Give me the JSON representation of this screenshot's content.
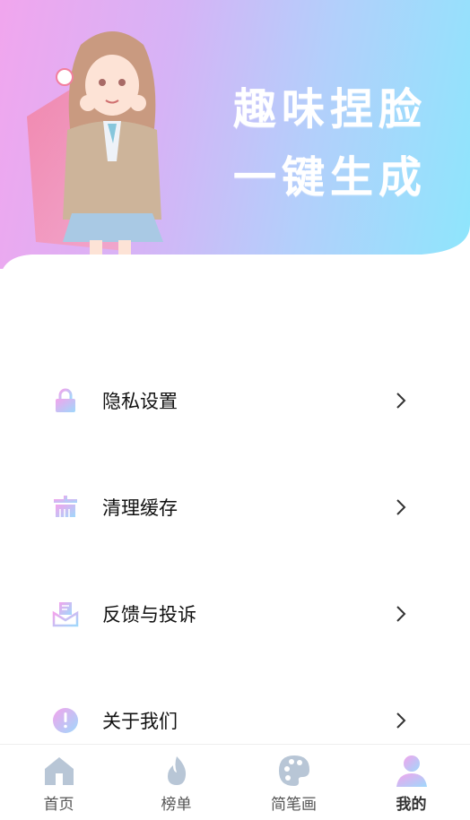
{
  "hero": {
    "slogan_line1": "趣味捏脸",
    "slogan_line2": "一键生成"
  },
  "menu": [
    {
      "label": "隐私设置",
      "icon": "lock-icon"
    },
    {
      "label": "清理缓存",
      "icon": "broom-icon"
    },
    {
      "label": "反馈与投诉",
      "icon": "feedback-envelope-icon"
    },
    {
      "label": "关于我们",
      "icon": "info-exclamation-icon"
    }
  ],
  "tabs": [
    {
      "label": "首页",
      "icon": "home-icon",
      "active": false
    },
    {
      "label": "榜单",
      "icon": "flame-icon",
      "active": false
    },
    {
      "label": "简笔画",
      "icon": "palette-icon",
      "active": false
    },
    {
      "label": "我的",
      "icon": "user-icon",
      "active": true
    }
  ],
  "colors": {
    "gradient_start": "#f1a6ee",
    "gradient_end": "#8ee6fc",
    "icon_pink": "#f3a4ec",
    "icon_blue": "#9fd8fb",
    "tab_inactive": "#b8c6d6"
  }
}
